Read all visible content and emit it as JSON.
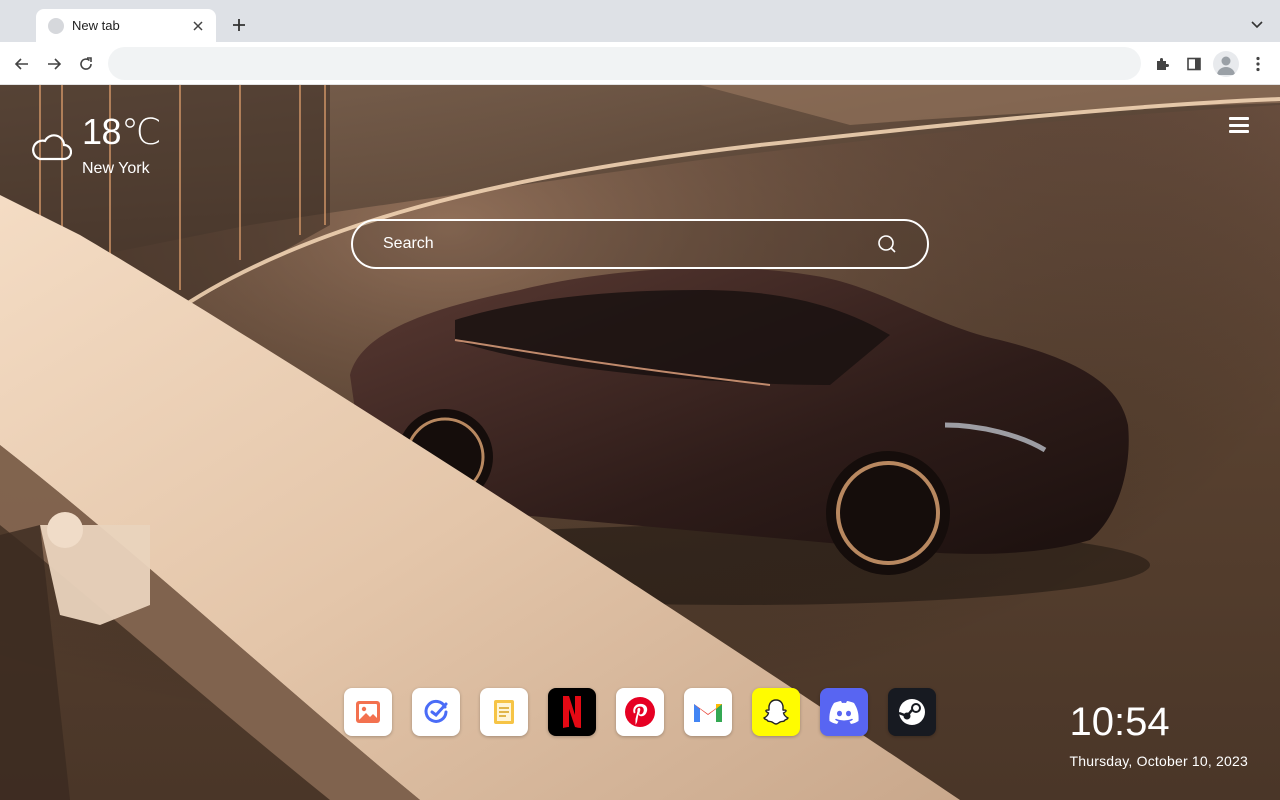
{
  "browser": {
    "tab": {
      "title": "New tab"
    },
    "omnibox": {
      "value": "",
      "placeholder": ""
    }
  },
  "weather": {
    "temperature": "18℃",
    "city": "New York",
    "icon": "cloud-icon"
  },
  "search": {
    "placeholder": "Search"
  },
  "dock": [
    {
      "name": "photos",
      "icon": "photos-icon",
      "bg": "#ffffff"
    },
    {
      "name": "tasks",
      "icon": "check-circle-icon",
      "bg": "#ffffff"
    },
    {
      "name": "notes",
      "icon": "notes-icon",
      "bg": "#ffffff"
    },
    {
      "name": "netflix",
      "icon": "netflix-icon",
      "bg": "#000000"
    },
    {
      "name": "pinterest",
      "icon": "pinterest-icon",
      "bg": "#ffffff"
    },
    {
      "name": "gmail",
      "icon": "gmail-icon",
      "bg": "#ffffff"
    },
    {
      "name": "snapchat",
      "icon": "snapchat-icon",
      "bg": "#fffc00"
    },
    {
      "name": "discord",
      "icon": "discord-icon",
      "bg": "#5865f2"
    },
    {
      "name": "steam",
      "icon": "steam-icon",
      "bg": "#171a21"
    }
  ],
  "clock": {
    "time": "10:54",
    "date": "Thursday, October 10, 2023"
  }
}
